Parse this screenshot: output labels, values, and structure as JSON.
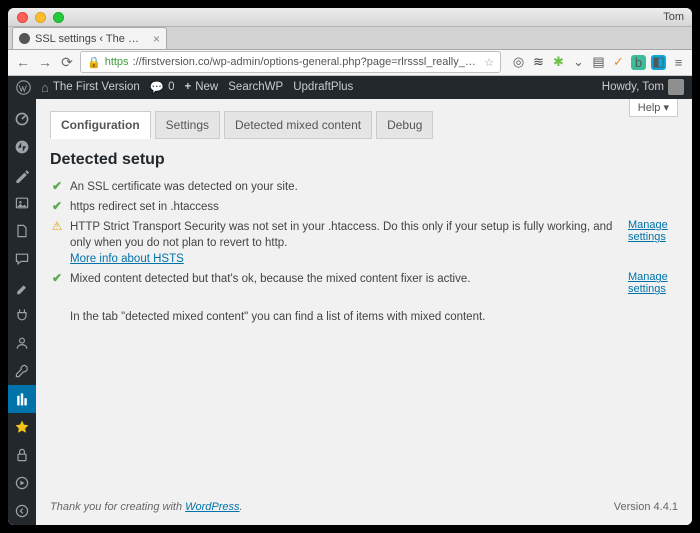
{
  "titlebar": {
    "user": "Tom"
  },
  "browser": {
    "tab_title": "SSL settings ‹ The First Ve…",
    "url_scheme": "https",
    "url_rest": "://firstversion.co/wp-admin/options-general.php?page=rlrsssl_really_simple_ssl"
  },
  "adminbar": {
    "site": "The First Version",
    "comments": "0",
    "new": "New",
    "searchwp": "SearchWP",
    "updraft": "UpdraftPlus",
    "howdy": "Howdy, Tom"
  },
  "help_label": "Help ▾",
  "tabs": {
    "config": "Configuration",
    "settings": "Settings",
    "mixed": "Detected mixed content",
    "debug": "Debug"
  },
  "section_title": "Detected setup",
  "rows": {
    "r1": "An SSL certificate was detected on your site.",
    "r2": "https redirect set in .htaccess",
    "r3": "HTTP Strict Transport Security was not set in your .htaccess. Do this only if your setup is fully working, and only when you do not plan to revert to http.",
    "r3_more": "More info about HSTS",
    "r3_link": "Manage settings",
    "r4": "Mixed content detected but that's ok, because the mixed content fixer is active.",
    "r4_link": "Manage settings"
  },
  "note": "In the tab \"detected mixed content\" you can find a list of items with mixed content.",
  "footer": {
    "thanks_pre": "Thank you for creating with ",
    "thanks_link": "WordPress",
    "thanks_post": ".",
    "version": "Version 4.4.1"
  }
}
